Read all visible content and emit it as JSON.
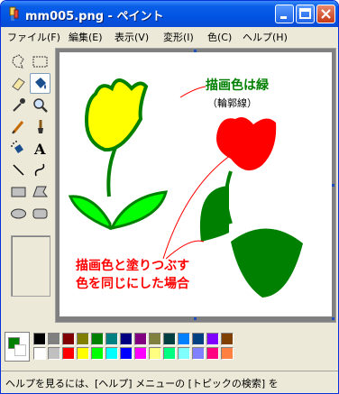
{
  "window": {
    "title": "mm005.png - ペイント"
  },
  "menu": [
    "ファイル(F)",
    "編集(E)",
    "表示(V)",
    "変形(I)",
    "色(C)",
    "ヘルプ(H)"
  ],
  "canvas_text": {
    "label_outline": "描画色は緑",
    "label_outline_sub": "（輪郭線）",
    "label_fill_line1": "描画色と塗りつぶす",
    "label_fill_line2": "色を同じにした場合"
  },
  "colors": {
    "current_foreground": "#008000",
    "current_background": "#ffffff",
    "palette_top": [
      "#000000",
      "#808080",
      "#800000",
      "#808000",
      "#008000",
      "#008080",
      "#000080",
      "#800080",
      "#808040",
      "#004040",
      "#0080ff",
      "#004080",
      "#8000ff",
      "#804000"
    ],
    "palette_bottom": [
      "#ffffff",
      "#c0c0c0",
      "#ff0000",
      "#ffff00",
      "#00ff00",
      "#00ffff",
      "#0000ff",
      "#ff00ff",
      "#ffff80",
      "#00ff80",
      "#80ffff",
      "#8080ff",
      "#ff0080",
      "#ff8040"
    ],
    "tulip_yellow": "#ffff00",
    "tulip_red": "#ff0000",
    "leaf_green": "#008000",
    "leaf_light_green": "#00ff00",
    "text_green": "#008000",
    "text_red": "#ff0000"
  },
  "status": {
    "text": "ヘルプを見るには、[ヘルプ] メニューの [トピックの検索] を"
  }
}
